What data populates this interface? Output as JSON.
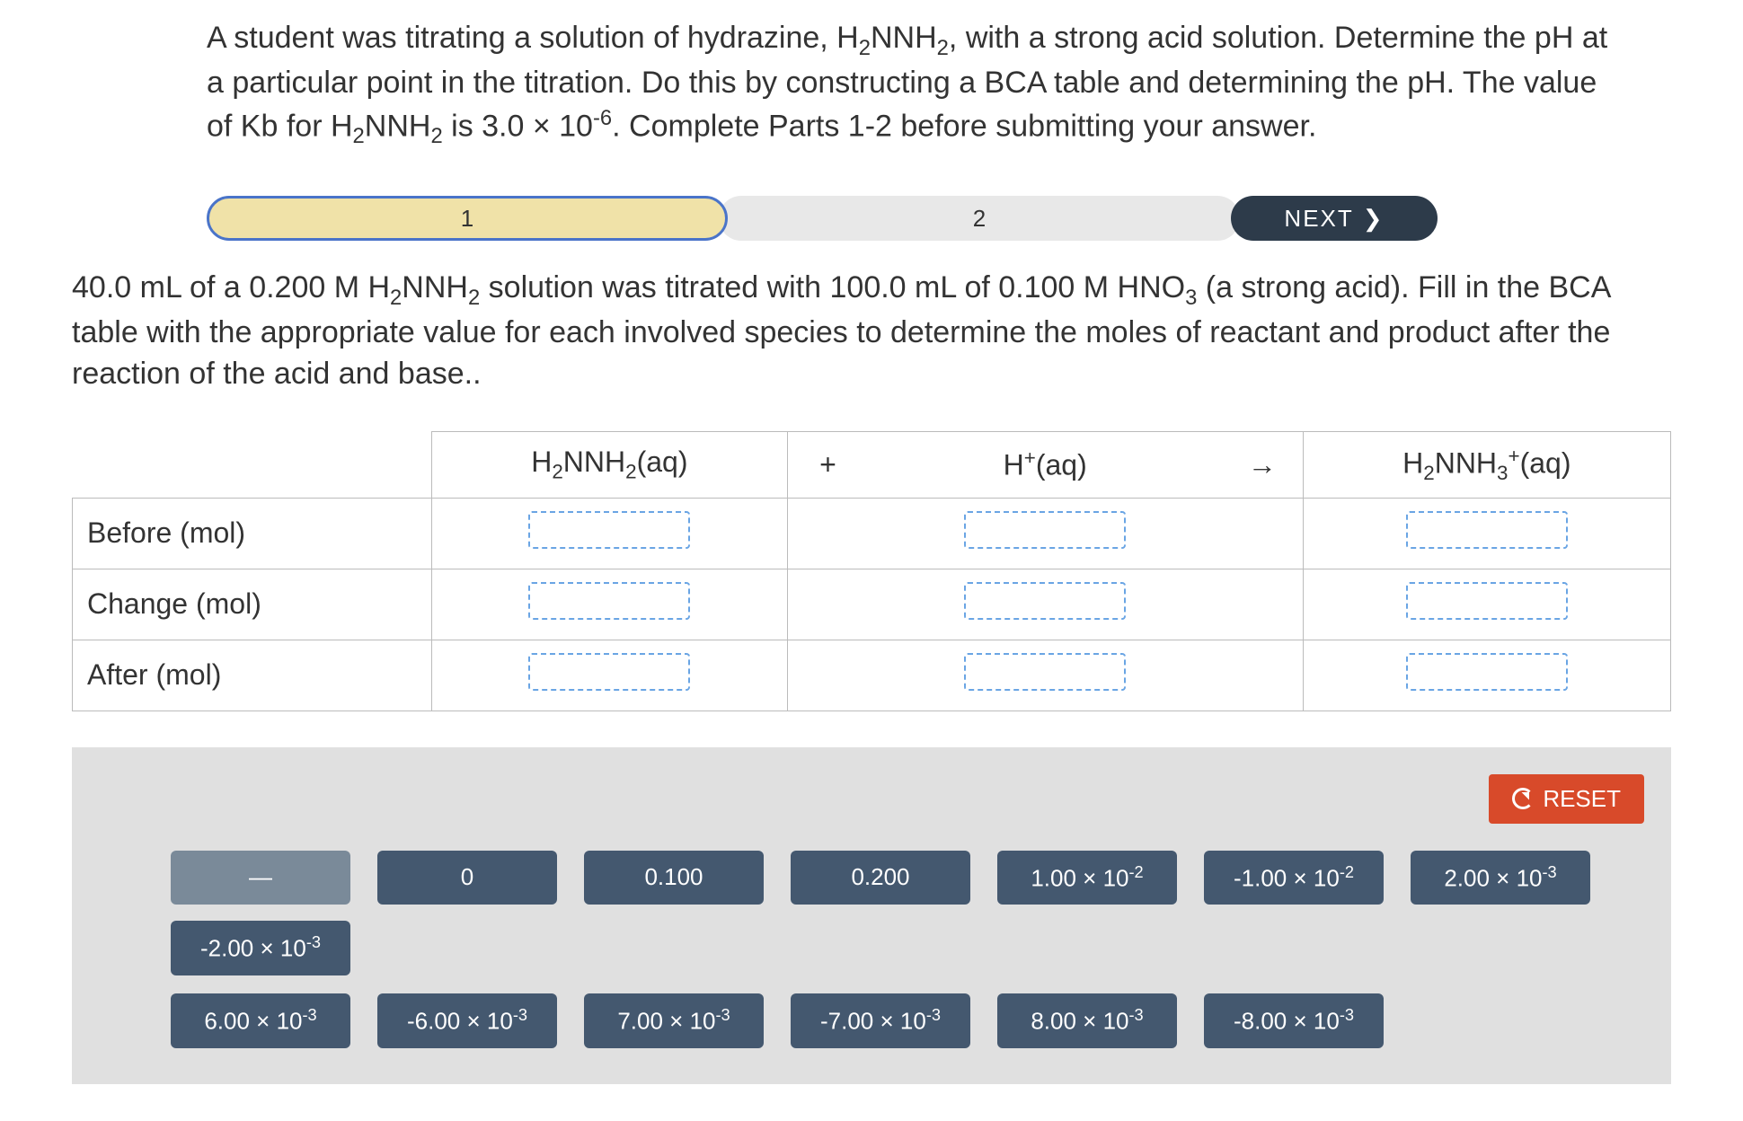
{
  "question_html": "A student was titrating a solution of hydrazine, H<sub>2</sub>NNH<sub>2</sub>, with a strong acid solution. Determine the pH at a particular point in the titration. Do this by constructing a BCA table and determining the pH. The value of Kb for H<sub>2</sub>NNH<sub>2</sub> is 3.0 × 10<sup>-6</sup>. Complete Parts 1-2 before submitting your answer.",
  "nav": {
    "tab1": "1",
    "tab2": "2",
    "next": "NEXT"
  },
  "sub_question_html": "40.0 mL of a 0.200 M H<sub>2</sub>NNH<sub>2</sub> solution was titrated with 100.0 mL of 0.100 M HNO<sub>3</sub> (a strong acid). Fill in the BCA table with the appropriate value for each involved species to determine the moles of reactant and product after the reaction of the acid and base..",
  "table": {
    "col1_html": "H<sub>2</sub>NNH<sub>2</sub>(aq)",
    "plus": "+",
    "col2_html": "H<sup>+</sup>(aq)",
    "arrow": "→",
    "col3_html": "H<sub>2</sub>NNH<sub>3</sub><sup>+</sup>(aq)",
    "rows": [
      "Before (mol)",
      "Change (mol)",
      "After (mol)"
    ]
  },
  "reset": "RESET",
  "tiles_row1": [
    {
      "label_html": "—",
      "blank": true
    },
    {
      "label_html": "0"
    },
    {
      "label_html": "0.100"
    },
    {
      "label_html": "0.200"
    },
    {
      "label_html": "1.00 × 10<sup>-2</sup>"
    },
    {
      "label_html": "-1.00 × 10<sup>-2</sup>"
    },
    {
      "label_html": "2.00 × 10<sup>-3</sup>"
    },
    {
      "label_html": "-2.00 × 10<sup>-3</sup>"
    }
  ],
  "tiles_row2": [
    {
      "label_html": "6.00 × 10<sup>-3</sup>"
    },
    {
      "label_html": "-6.00 × 10<sup>-3</sup>"
    },
    {
      "label_html": "7.00 × 10<sup>-3</sup>"
    },
    {
      "label_html": "-7.00 × 10<sup>-3</sup>"
    },
    {
      "label_html": "8.00 × 10<sup>-3</sup>"
    },
    {
      "label_html": "-8.00 × 10<sup>-3</sup>"
    }
  ]
}
